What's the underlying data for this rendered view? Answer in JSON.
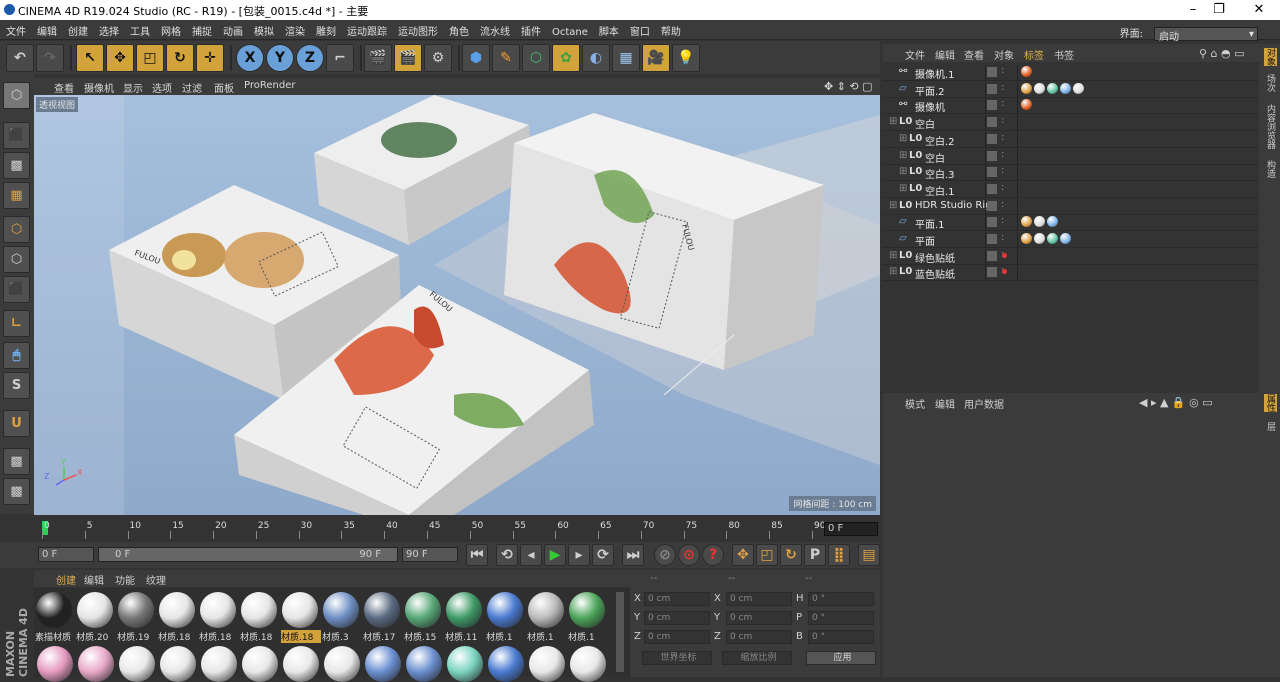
{
  "titlebar": {
    "title": "CINEMA 4D R19.024 Studio (RC - R19) - [包装_0015.c4d *] - 主要"
  },
  "menu": [
    "文件",
    "编辑",
    "创建",
    "选择",
    "工具",
    "网格",
    "捕捉",
    "动画",
    "模拟",
    "渲染",
    "雕刻",
    "运动跟踪",
    "运动图形",
    "角色",
    "流水线",
    "插件",
    "Octane",
    "脚本",
    "窗口",
    "帮助"
  ],
  "interface": {
    "label": "界面:",
    "value": "启动"
  },
  "viewport": {
    "menu": [
      "查看",
      "摄像机",
      "显示",
      "选项",
      "过滤",
      "面板",
      "ProRender"
    ],
    "label": "透视视图",
    "grid_label": "网格间距 : 100 cm",
    "axes": [
      "Y",
      "X",
      "Z"
    ]
  },
  "timeline": {
    "ticks": [
      "0",
      "5",
      "10",
      "15",
      "20",
      "25",
      "30",
      "35",
      "40",
      "45",
      "50",
      "55",
      "60",
      "65",
      "70",
      "75",
      "80",
      "85",
      "90"
    ],
    "frame_field": "0 F",
    "start": "0 F",
    "range_start": "0 F",
    "range_end": "90 F",
    "end": "90 F"
  },
  "materials": {
    "menu": [
      "创建",
      "编辑",
      "功能",
      "纹理"
    ],
    "items": [
      {
        "name": "素描材质",
        "color": "#222"
      },
      {
        "name": "材质.20",
        "color": "#e6e6e6"
      },
      {
        "name": "材质.19",
        "color": "#777"
      },
      {
        "name": "材质.18",
        "color": "#e6e6e6"
      },
      {
        "name": "材质.18",
        "color": "#e6e6e6"
      },
      {
        "name": "材质.18",
        "color": "#e6e6e6"
      },
      {
        "name": "材质.18",
        "color": "#e6e6e6",
        "highlight": true
      },
      {
        "name": "材质.3",
        "color": "#6e8fc4"
      },
      {
        "name": "材质.17",
        "color": "#5b6a82"
      },
      {
        "name": "材质.15",
        "color": "#58a878"
      },
      {
        "name": "材质.11",
        "color": "#3f9a68"
      },
      {
        "name": "材质.1",
        "color": "#4a7ad0"
      },
      {
        "name": "材质.1",
        "color": "#bbb"
      },
      {
        "name": "材质.1",
        "color": "#4ca55a"
      }
    ],
    "row2": [
      "#e59ac0",
      "#e8a8c8",
      "#e8e8e8",
      "#e8e8e8",
      "#e8e8e8",
      "#e8e8e8",
      "#e8e8e8",
      "#e8e8e8",
      "#6b8fd0",
      "#6b8fd0",
      "#7bd4c0",
      "#4a7ad0",
      "#e8e8e8",
      "#e8e8e8"
    ]
  },
  "coords": {
    "headers": [
      "--",
      "--",
      "--"
    ],
    "rows": [
      {
        "a": "X",
        "av": "0 cm",
        "b": "X",
        "bv": "0 cm",
        "c": "H",
        "cv": "0 °"
      },
      {
        "a": "Y",
        "av": "0 cm",
        "b": "Y",
        "bv": "0 cm",
        "c": "P",
        "cv": "0 °"
      },
      {
        "a": "Z",
        "av": "0 cm",
        "b": "Z",
        "bv": "0 cm",
        "c": "B",
        "cv": "0 °"
      }
    ],
    "world": "世界坐标",
    "scale": "缩放比例",
    "apply": "应用"
  },
  "objects": {
    "menu": [
      "文件",
      "编辑",
      "查看",
      "对象",
      "标签",
      "书签"
    ],
    "rows": [
      {
        "name": "摄像机.1",
        "indent": 0,
        "icon": "camera"
      },
      {
        "name": "平面.2",
        "indent": 0,
        "icon": "plane"
      },
      {
        "name": "摄像机",
        "indent": 0,
        "icon": "camera"
      },
      {
        "name": "空白",
        "indent": 0,
        "icon": "null"
      },
      {
        "name": "空白.2",
        "indent": 1,
        "icon": "null"
      },
      {
        "name": "空白",
        "indent": 1,
        "icon": "null"
      },
      {
        "name": "空白.3",
        "indent": 1,
        "icon": "null"
      },
      {
        "name": "空白.1",
        "indent": 1,
        "icon": "null"
      },
      {
        "name": "HDR Studio Rig",
        "indent": 0,
        "icon": "null"
      },
      {
        "name": "平面.1",
        "indent": 0,
        "icon": "plane"
      },
      {
        "name": "平面",
        "indent": 0,
        "icon": "plane"
      },
      {
        "name": "绿色贴纸",
        "indent": 0,
        "icon": "null"
      },
      {
        "name": "蓝色贴纸",
        "indent": 0,
        "icon": "null"
      }
    ]
  },
  "attributes": {
    "menu": [
      "模式",
      "编辑",
      "用户数据"
    ]
  },
  "right_tabs": [
    "对象",
    "场次",
    "内容浏览器",
    "构造"
  ],
  "right_tabs2": [
    "属性",
    "层"
  ],
  "brand": "MAXON CINEMA 4D",
  "scene_text": {
    "brand": "FULOU"
  }
}
